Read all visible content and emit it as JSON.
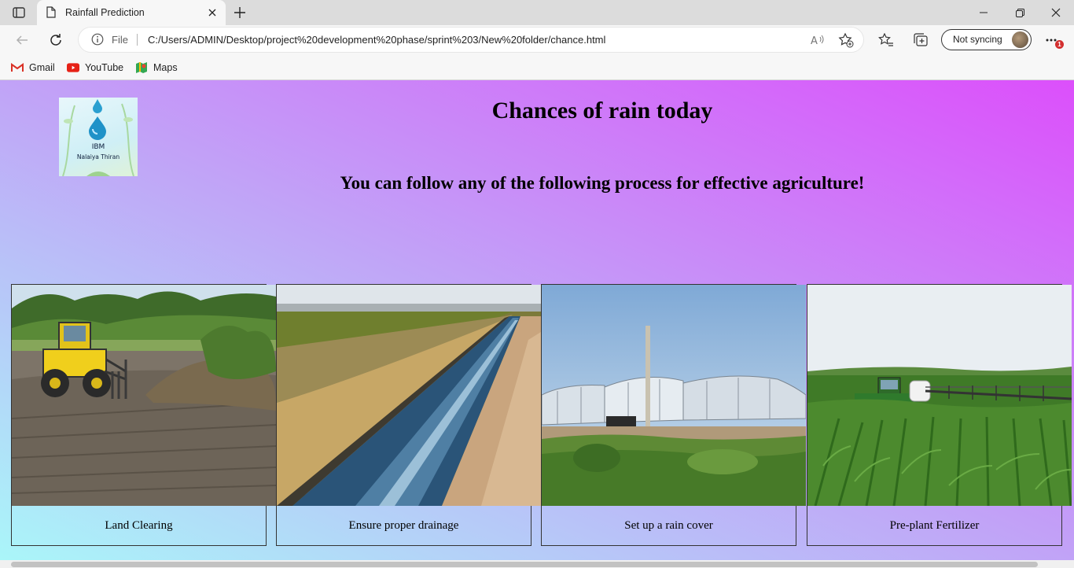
{
  "browser": {
    "tab_title": "Rainfall Prediction",
    "address": {
      "scheme_label": "File",
      "url": "C:/Users/ADMIN/Desktop/project%20development%20phase/sprint%203/New%20folder/chance.html"
    },
    "profile": {
      "label": "Not syncing"
    },
    "notification_count": "1",
    "favorites": [
      {
        "label": "Gmail",
        "icon": "gmail-icon"
      },
      {
        "label": "YouTube",
        "icon": "youtube-icon"
      },
      {
        "label": "Maps",
        "icon": "maps-icon"
      }
    ]
  },
  "page": {
    "logo": {
      "line1": "IBM",
      "line2": "Nalaiya Thiran"
    },
    "title": "Chances of rain today",
    "subtitle": "You can follow any of the following process for effective agriculture!",
    "cards": [
      {
        "label": "Land Clearing",
        "image": "bulldozer clearing land"
      },
      {
        "label": "Ensure proper drainage",
        "image": "irrigation canal through field"
      },
      {
        "label": "Set up a rain cover",
        "image": "greenhouse shelters on farm"
      },
      {
        "label": "Pre-plant Fertilizer",
        "image": "tractor spraying corn field"
      }
    ]
  },
  "colors": {
    "gradient_start": "#aaf6f9",
    "gradient_mid": "#c1a3f7",
    "gradient_end": "#dc4ffb"
  }
}
